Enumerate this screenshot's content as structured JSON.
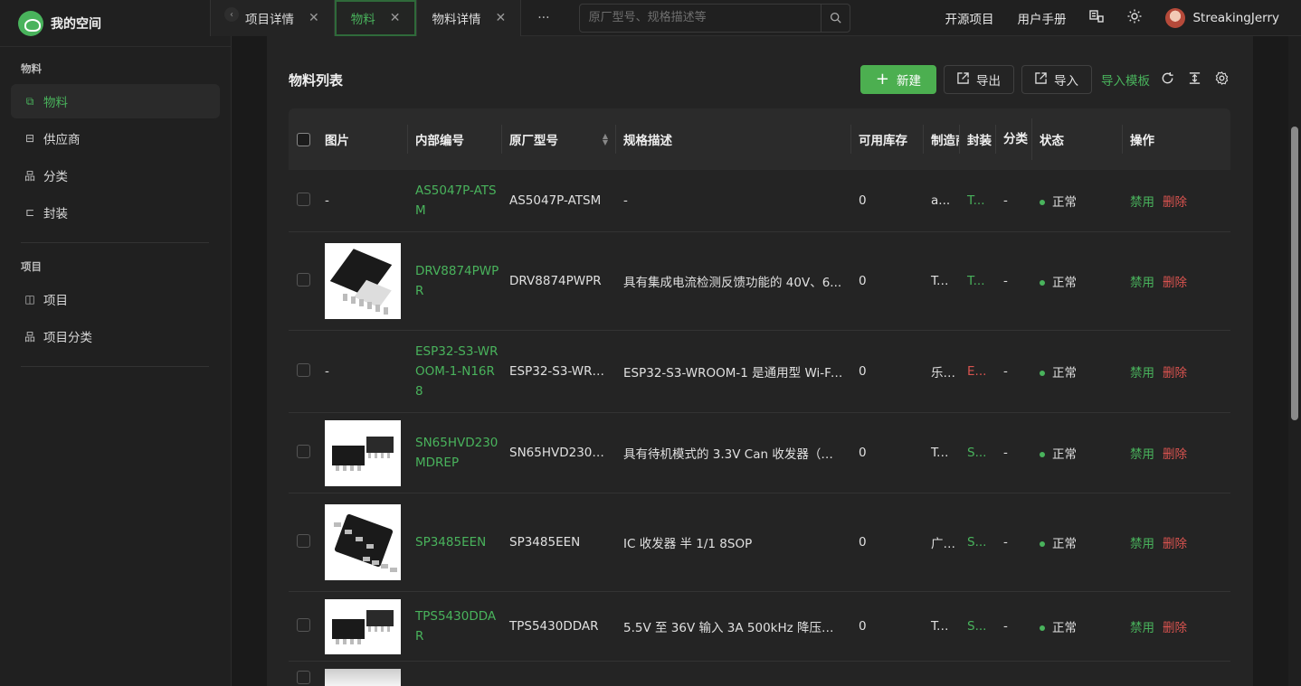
{
  "brand": {
    "title": "我的空间"
  },
  "sidebar": {
    "groups": [
      {
        "title": "物料",
        "items": [
          {
            "label": "物料",
            "icon": "material-icon",
            "active": true
          },
          {
            "label": "供应商",
            "icon": "supplier-icon"
          },
          {
            "label": "分类",
            "icon": "category-icon"
          },
          {
            "label": "封装",
            "icon": "package-icon"
          }
        ]
      },
      {
        "title": "项目",
        "items": [
          {
            "label": "项目",
            "icon": "project-icon"
          },
          {
            "label": "项目分类",
            "icon": "project-category-icon"
          }
        ]
      }
    ]
  },
  "tabs": [
    {
      "label": "项目详情"
    },
    {
      "label": "物料",
      "active": true
    },
    {
      "label": "物料详情"
    }
  ],
  "tab_more": "···",
  "search": {
    "placeholder": "原厂型号、规格描述等"
  },
  "topnav": {
    "open_source": "开源项目",
    "manual": "用户手册",
    "username": "StreakingJerry"
  },
  "page": {
    "title": "物料列表"
  },
  "toolbar": {
    "new_label": "新建",
    "export_label": "导出",
    "import_label": "导入",
    "template_label": "导入模板"
  },
  "table": {
    "headers": {
      "image": "图片",
      "code": "内部编号",
      "model": "原厂型号",
      "desc": "规格描述",
      "stock": "可用库存",
      "mfr": "制造商",
      "pkg": "封装",
      "cat": "分类",
      "status": "状态",
      "ops": "操作"
    },
    "rows": [
      {
        "image": "-",
        "code": "AS5047P-ATSM",
        "model": "AS5047P-ATSM",
        "desc": "-",
        "stock": "0",
        "mfr": "a...",
        "pkg": "T...",
        "pkg_color": "green",
        "cat": "-",
        "status": "正常",
        "disable": "禁用",
        "delete": "删除",
        "height": 69
      },
      {
        "image": "chip-htssop",
        "code": "DRV8874PWPR",
        "model": "DRV8874PWPR",
        "desc": "具有集成电流检测反馈功能的 40V、6...",
        "stock": "0",
        "mfr": "Te...",
        "pkg": "T...",
        "pkg_color": "green",
        "cat": "-",
        "status": "正常",
        "disable": "禁用",
        "delete": "删除",
        "height": 109
      },
      {
        "image": "-",
        "code": "ESP32-S3-WROOM-1-N16R8",
        "model": "ESP32-S3-WRO...",
        "desc": "ESP32-S3-WROOM-1 是通用型 Wi-Fi ...",
        "stock": "0",
        "mfr": "乐...",
        "pkg": "E...",
        "pkg_color": "red",
        "cat": "-",
        "status": "正常",
        "disable": "禁用",
        "delete": "删除",
        "height": 91
      },
      {
        "image": "chip-soic-pair",
        "code": "SN65HVD230MDREP",
        "model": "SN65HVD230M...",
        "desc": "具有待机模式的 3.3V Can 收发器（增...",
        "stock": "0",
        "mfr": "Te...",
        "pkg": "S...",
        "pkg_color": "green",
        "cat": "-",
        "status": "正常",
        "disable": "禁用",
        "delete": "删除",
        "height": 89
      },
      {
        "image": "chip-soic",
        "code": "SP3485EEN",
        "model": "SP3485EEN",
        "desc": "IC 收发器 半 1/1 8SOP",
        "stock": "0",
        "mfr": "广...",
        "pkg": "S...",
        "pkg_color": "green",
        "cat": "-",
        "status": "正常",
        "disable": "禁用",
        "delete": "删除",
        "height": 109
      },
      {
        "image": "chip-soic-pair",
        "code": "TPS5430DDAR",
        "model": "TPS5430DDAR",
        "desc": "5.5V 至 36V 输入 3A 500kHz 降压转...",
        "stock": "0",
        "mfr": "Te...",
        "pkg": "S...",
        "pkg_color": "green",
        "cat": "-",
        "status": "正常",
        "disable": "禁用",
        "delete": "删除",
        "height": 77
      },
      {
        "image": "chip-partial",
        "code": "",
        "model": "",
        "desc": "",
        "stock": "",
        "mfr": "",
        "pkg": "",
        "pkg_color": "green",
        "cat": "",
        "status": "",
        "disable": "",
        "delete": "",
        "height": 40
      }
    ]
  },
  "colors": {
    "accent": "#49b35c",
    "danger": "#d9534f"
  }
}
